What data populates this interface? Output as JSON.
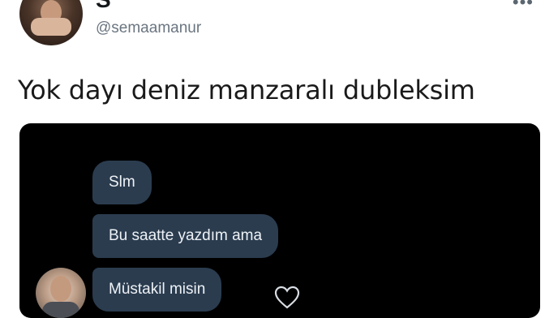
{
  "author": {
    "display_name": "S",
    "handle": "@semaamanur"
  },
  "tweet": {
    "text": "Yok dayı deniz manzaralı dubleksim",
    "more_icon": "more-horizontal-icon"
  },
  "media": {
    "messages": [
      {
        "text": "Slm"
      },
      {
        "text": "Bu saatte yazdım ama"
      },
      {
        "text": "Müstakil misin"
      }
    ],
    "reaction_icon": "heart-outline-icon"
  },
  "colors": {
    "bubble_bg": "#2b3c4f",
    "bubble_text": "#eef2f6",
    "media_bg": "#000000",
    "handle_text": "#6a7580"
  }
}
